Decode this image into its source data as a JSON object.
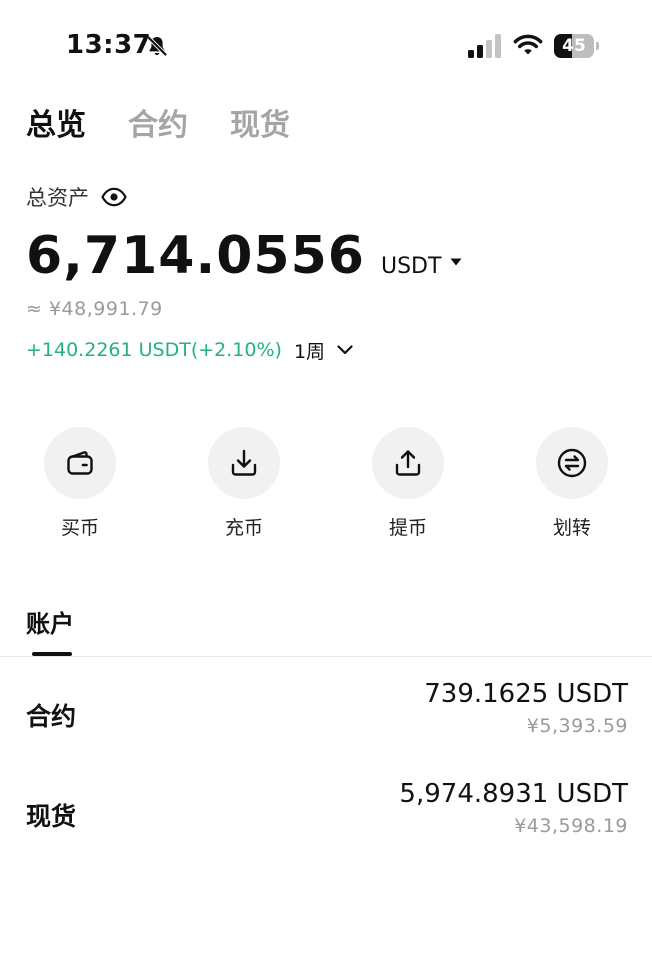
{
  "status_bar": {
    "time": "13:37",
    "battery_percent": "45",
    "battery_level": 0.45
  },
  "top_tabs": [
    {
      "label": "总览",
      "active": true
    },
    {
      "label": "合约",
      "active": false
    },
    {
      "label": "现货",
      "active": false
    }
  ],
  "overview": {
    "total_label": "总资产",
    "total_value": "6,714.0556",
    "total_unit": "USDT",
    "cny_equivalent": "≈ ¥48,991.79",
    "pnl": "+140.2261 USDT(+2.10%)",
    "pnl_period": "1周"
  },
  "actions": [
    {
      "label": "买币",
      "icon": "wallet-icon"
    },
    {
      "label": "充币",
      "icon": "deposit-icon"
    },
    {
      "label": "提币",
      "icon": "withdraw-icon"
    },
    {
      "label": "划转",
      "icon": "transfer-icon"
    }
  ],
  "accounts_section": {
    "tab_label": "账户",
    "rows": [
      {
        "name": "合约",
        "amount": "739.1625 USDT",
        "cny": "¥5,393.59"
      },
      {
        "name": "现货",
        "amount": "5,974.8931 USDT",
        "cny": "¥43,598.19"
      }
    ]
  },
  "colors": {
    "positive": "#24b37a",
    "text_primary": "#111111",
    "text_secondary": "#9a9a9a",
    "tab_inactive": "#a5a5a5",
    "action_bg": "#f1f1f1"
  }
}
